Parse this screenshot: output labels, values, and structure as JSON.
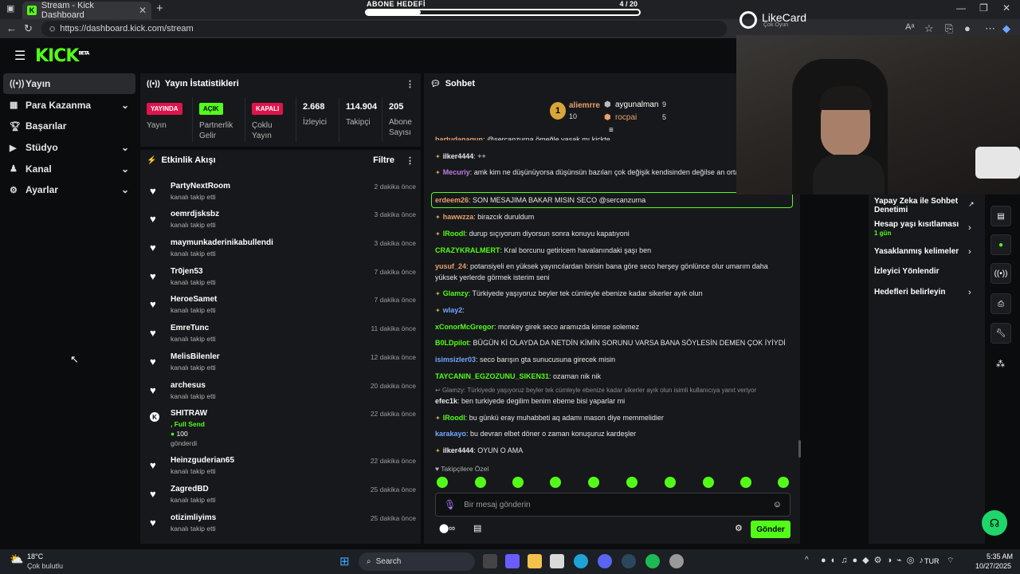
{
  "browser": {
    "tab_title": "Stream - Kick Dashboard",
    "url": "https://dashboard.kick.com/stream"
  },
  "goal": {
    "label": "ABONE HEDEFİ",
    "count": "4 / 20",
    "progress": 0.2
  },
  "overlay_brand": {
    "name": "LikeCard",
    "tagline": "Çok Oyun"
  },
  "header": {
    "logo": "KICK",
    "logo_tag": "BETA"
  },
  "nav": {
    "items": [
      {
        "label": "Yayın",
        "icon": "broadcast-icon",
        "chevron": ""
      },
      {
        "label": "Para Kazanma",
        "icon": "money-icon",
        "chevron": "⌄"
      },
      {
        "label": "Başarılar",
        "icon": "trophy-icon",
        "chevron": ""
      },
      {
        "label": "Stüdyo",
        "icon": "studio-icon",
        "chevron": "⌄"
      },
      {
        "label": "Kanal",
        "icon": "channel-icon",
        "chevron": "⌄"
      },
      {
        "label": "Ayarlar",
        "icon": "gear-icon",
        "chevron": "⌄"
      }
    ]
  },
  "stats": {
    "title": "Yayın İstatistikleri",
    "live_badge": "YAYINDA",
    "live_label": "Yayın",
    "partner_badge": "AÇIK",
    "partner_label": "Partnerlik Gelir",
    "multi_badge": "KAPALI",
    "multi_label": "Çoklu Yayın",
    "viewers": "2.668",
    "viewers_label": "İzleyici",
    "followers": "114.904",
    "followers_label": "Takipçi",
    "subs": "205",
    "subs_label": "Abone Sayısı"
  },
  "activity": {
    "title": "Etkinlik Akışı",
    "filter": "Filtre",
    "items": [
      {
        "name": "PartyNextRoom",
        "sub": "kanalı takip etti",
        "time": "2 dakika önce"
      },
      {
        "name": "oemrdjsksbz",
        "sub": "kanalı takip etti",
        "time": "3 dakika önce"
      },
      {
        "name": "maymunkaderinikabullendi",
        "sub": "kanalı takip etti",
        "time": "3 dakika önce"
      },
      {
        "name": "Tr0jen53",
        "sub": "kanalı takip etti",
        "time": "7 dakika önce"
      },
      {
        "name": "HeroeSamet",
        "sub": "kanalı takip etti",
        "time": "7 dakika önce"
      },
      {
        "name": "EmreTunc",
        "sub": "kanalı takip etti",
        "time": "11 dakika önce"
      },
      {
        "name": "MelisBilenler",
        "sub": "kanalı takip etti",
        "time": "12 dakika önce"
      },
      {
        "name": "archesus",
        "sub": "kanalı takip etti",
        "time": "20 dakika önce"
      }
    ],
    "send": {
      "name": "SHITRAW",
      "note": ", Full Send",
      "amount": "100",
      "sub": "gönderdi",
      "time": "22 dakika önce"
    },
    "items2": [
      {
        "name": "Heinzguderian65",
        "sub": "kanalı takip etti",
        "time": "22 dakika önce"
      },
      {
        "name": "ZagredBD",
        "sub": "kanalı takip etti",
        "time": "25 dakika önce"
      },
      {
        "name": "otizimliyims",
        "sub": "kanalı takip etti",
        "time": "25 dakika önce"
      }
    ]
  },
  "chat": {
    "title": "Sohbet",
    "top": [
      {
        "rank": "1",
        "name": "aliemrre",
        "value": "10"
      },
      {
        "name": "aygunalman",
        "value": "9"
      },
      {
        "name": "rocpai",
        "value": "5"
      }
    ],
    "messages": [
      {
        "user": "bartudanagun",
        "color": "#e7a16b",
        "text": ": @sercanzurna ömeğle yasak mı kickte"
      },
      {
        "user": "ilker4444",
        "color": "#e8e8e8",
        "text": ": ++"
      },
      {
        "user": "Mecuriy",
        "color": "#c07be6",
        "text": ": amk kim ne düşünüyorsa düşünsün bazıları çok değişik kendisinden değilse an ortalıpıb"
      },
      {
        "user": "erdeem26",
        "color": "#e7a16b",
        "text": ": SON MESAJIMA BAKAR MISIN SECO @sercanzurna"
      },
      {
        "user": "hawwzza",
        "color": "#e7a16b",
        "text": ": birazcık duruldum"
      },
      {
        "user": "lRoodl",
        "color": "#53fc18",
        "text": ": durup sıçıyorum diyorsun sonra konuyu kapatıyoni"
      },
      {
        "user": "CRAZYKRALMERT",
        "color": "#53fc18",
        "text": ": Kral borcunu getiricem havalanındaki şaşı ben"
      },
      {
        "user": "yusuf_24",
        "color": "#e7a16b",
        "text": ": potansiyeli en yüksek yayıncılardan birisin bana göre seco herşey gönlünce olur umarım daha yüksek yerlerde görmek isterim seni"
      },
      {
        "user": "Glamzy",
        "color": "#53fc18",
        "text": ": Türkiyede yaşıyoruz beyler tek cümleyle ebenize kadar sikerler ayık olun"
      },
      {
        "user": "wlay2",
        "color": "#6fa8ff",
        "text": ":"
      },
      {
        "user": "xConorMcGregor",
        "color": "#53fc18",
        "text": ": monkey girek seco aramızda kimse solemez"
      },
      {
        "user": "B0LDpilot",
        "color": "#53fc18",
        "text": ": BÜGÜN Kİ OLAYDA DA NETDİN KİMİN SORUNU VARSA BANA SÖYLESİN DEMEN ÇOK İYİYDİ"
      },
      {
        "user": "isimsizler03",
        "color": "#6fa8ff",
        "text": ": seco barışın gta sunucusuna girecek misin"
      },
      {
        "user": "TAYCANIN_EGZOZUNU_SIKEN31",
        "color": "#53fc18",
        "text": ": ozaman nik nik"
      },
      {
        "user": "efec1k",
        "color": "#e8e8e8",
        "text": ": ben turkiyede degilim benim ebeme bisi yaparlar mi"
      },
      {
        "user": "lRoodl",
        "color": "#53fc18",
        "text": ": bu günkü eray muhabbeti aq adamı mason diye memmelidier"
      },
      {
        "user": "karakayo",
        "color": "#6fa8ff",
        "text": ": bu devran elbet döner o zaman konuşuruz kardeşler"
      },
      {
        "user": "ilker4444",
        "color": "#e8e8e8",
        "text": ": OYUN O AMA"
      }
    ],
    "reply_hint": "Glamzy: Türkiyede yaşıyoruz beyler tek cümleyle ebenize kadar sikerler ayık olun isimli kullanıcıya yanıt veriyor",
    "followers_only": "Takipçilere Özel",
    "input_placeholder": "Bir mesaj gönderin",
    "send": "Gönder"
  },
  "right_panel": {
    "items": [
      {
        "label": "Yapay Zeka ile Sohbet Denetimi"
      },
      {
        "label": "Hesap yaşı kısıtlaması",
        "sub": "1 gün"
      },
      {
        "label": "Yasaklanmış kelimeler"
      },
      {
        "label": "İzleyici Yönlendir"
      },
      {
        "label": "Hedefleri belirleyin"
      }
    ]
  },
  "taskbar": {
    "weather_temp": "18°C",
    "weather_text": "Çok bulutlu",
    "search": "Search",
    "lang": "TUR",
    "time": "5:35 AM",
    "date": "10/27/2025"
  }
}
